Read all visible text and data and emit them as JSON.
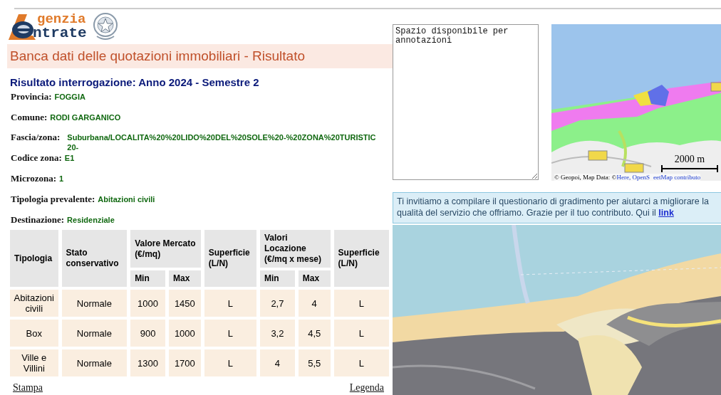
{
  "logo": {
    "line1": "genzia",
    "line2": "ntrate"
  },
  "page_title": "Banca dati delle quotazioni immobiliari - Risultato",
  "result_heading": "Risultato interrogazione: Anno 2024 - Semestre 2",
  "fields": [
    {
      "label": "Provincia:",
      "value_lines": [
        "FOGGIA"
      ]
    },
    {
      "label": "Comune:",
      "value_lines": [
        "RODI GARGANICO"
      ]
    },
    {
      "label": "Fascia/zona:",
      "value_lines": [
        "Suburbana/LOCALITA%20%20LIDO%20DEL%20SOLE%20-%20ZONA%20TURISTIC",
        "20-"
      ]
    },
    {
      "label": "Codice zona:",
      "value_lines": [
        "E1"
      ]
    },
    {
      "label": "Microzona:",
      "value_lines": [
        "1"
      ]
    },
    {
      "label": "Tipologia prevalente:",
      "value_lines": [
        "Abitazioni civili"
      ]
    },
    {
      "label": "Destinazione:",
      "value_lines": [
        "Residenziale"
      ]
    }
  ],
  "table": {
    "column_groups": [
      "Valore Mercato (€/mq)",
      "Valori Locazione (€/mq x mese)"
    ],
    "columns": [
      {
        "label": "Tipologia",
        "grouped": false
      },
      {
        "label": "Stato conservativo",
        "grouped": false
      },
      {
        "label": "Min",
        "grouped": true
      },
      {
        "label": "Max",
        "grouped": true
      },
      {
        "label": "Superficie (L/N)",
        "grouped": false
      },
      {
        "label": "Min",
        "grouped": true
      },
      {
        "label": "Max",
        "grouped": true
      },
      {
        "label": "Superficie (L/N)",
        "grouped": false
      }
    ],
    "rows": [
      [
        "Abitazioni civili",
        "Normale",
        "1000",
        "1450",
        "L",
        "2,7",
        "4",
        "L"
      ],
      [
        "Box",
        "Normale",
        "900",
        "1000",
        "L",
        "3,2",
        "4,5",
        "L"
      ],
      [
        "Ville e Villini",
        "Normale",
        "1300",
        "1700",
        "L",
        "4",
        "5,5",
        "L"
      ]
    ]
  },
  "links": [
    "Stampa",
    "Legenda"
  ],
  "notes": {
    "value": "Spazio disponibile per annotazioni"
  },
  "small_map": {
    "kind": "picture",
    "scale": "2000 m",
    "attribution_parts": [
      "© Geopoi, Map Data: © ",
      "Here, OpenS",
      "eetMap contributo"
    ]
  },
  "notice": {
    "text": "Ti invitiamo a compilare il questionario di gradimento per aiutarci a migliorare la qualità del servizio che offriamo. Grazie per il tuo contributo. Qui il",
    "link": "link"
  },
  "large_map": {
    "kind": "picture"
  }
}
